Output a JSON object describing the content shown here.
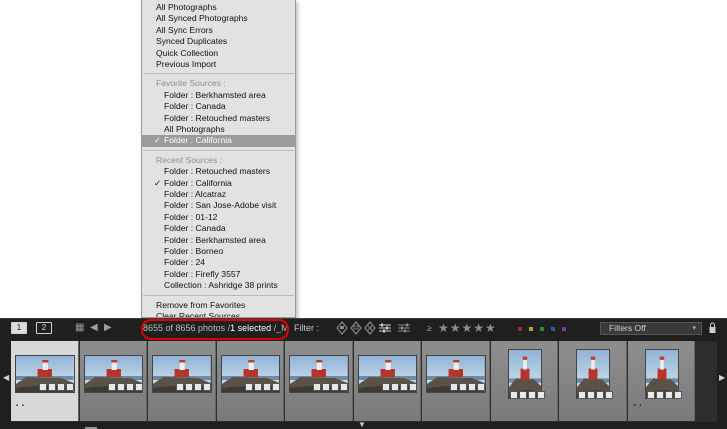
{
  "source_menu": {
    "items": [
      {
        "label": "All Photographs",
        "type": "item",
        "level": 0
      },
      {
        "label": "All Synced Photographs",
        "type": "item",
        "level": 0
      },
      {
        "label": "All Sync Errors",
        "type": "item",
        "level": 0
      },
      {
        "label": "Synced Duplicates",
        "type": "item",
        "level": 0
      },
      {
        "label": "Quick Collection",
        "type": "item",
        "level": 0
      },
      {
        "label": "Previous Import",
        "type": "item",
        "level": 0
      },
      {
        "label": "Favorite Sources :",
        "type": "header",
        "level": 0
      },
      {
        "label": "Folder : Berkhamsted area",
        "type": "item",
        "level": 1
      },
      {
        "label": "Folder : Canada",
        "type": "item",
        "level": 1
      },
      {
        "label": "Folder : Retouched masters",
        "type": "item",
        "level": 1
      },
      {
        "label": "All Photographs",
        "type": "item",
        "level": 1
      },
      {
        "label": "Folder : California",
        "type": "item",
        "level": 1,
        "checked": true,
        "highlighted": true
      },
      {
        "label": "Recent Sources :",
        "type": "header",
        "level": 0
      },
      {
        "label": "Folder : Retouched masters",
        "type": "item",
        "level": 1
      },
      {
        "label": "Folder : California",
        "type": "item",
        "level": 1,
        "checked": true
      },
      {
        "label": "Folder : Alcatraz",
        "type": "item",
        "level": 1
      },
      {
        "label": "Folder : San Jose-Adobe visit",
        "type": "item",
        "level": 1
      },
      {
        "label": "Folder : 01-12",
        "type": "item",
        "level": 1
      },
      {
        "label": "Folder : Canada",
        "type": "item",
        "level": 1
      },
      {
        "label": "Folder : Berkhamsted area",
        "type": "item",
        "level": 1
      },
      {
        "label": "Folder : Borneo",
        "type": "item",
        "level": 1
      },
      {
        "label": "Folder : 24",
        "type": "item",
        "level": 1
      },
      {
        "label": "Folder : Firefly 3557",
        "type": "item",
        "level": 1
      },
      {
        "label": "Collection : Ashridge 38 prints",
        "type": "item",
        "level": 1
      },
      {
        "label": "Remove from Favorites",
        "type": "item",
        "level": 0
      },
      {
        "label": "Clear Recent Sources",
        "type": "item",
        "level": 0
      }
    ],
    "check_glyph": "✓",
    "highlight_color": "#9b9b9b"
  },
  "filmstrip_toolbar": {
    "view1": "1",
    "view2": "2",
    "back_arrow": "◀",
    "forward_arrow": "▶",
    "photo_count": "8655 of 8656 photos /",
    "selected_text": "1 selected",
    "path_text": " /_M",
    "filter_label": "Filter :",
    "rating_op": "≥",
    "stars": "★★★★★",
    "color_labels": [
      "#a02828",
      "#b5a52a",
      "#2f8a2f",
      "#2c55b0",
      "#7a3a9a"
    ],
    "filter_preset": "Filters Off",
    "dropdown_glyph": "▾",
    "annotation_color": "#e00000"
  },
  "filmstrip": {
    "left_arrow": "◀",
    "right_arrow": "▶",
    "collapse_arrow": "▼",
    "thumbnail_count": 10,
    "selected_index": 0,
    "thumbnail_subject": "lighthouse-on-rocky-shore",
    "dots_glyph": "▪ ▪",
    "star_glyph": "▸"
  }
}
